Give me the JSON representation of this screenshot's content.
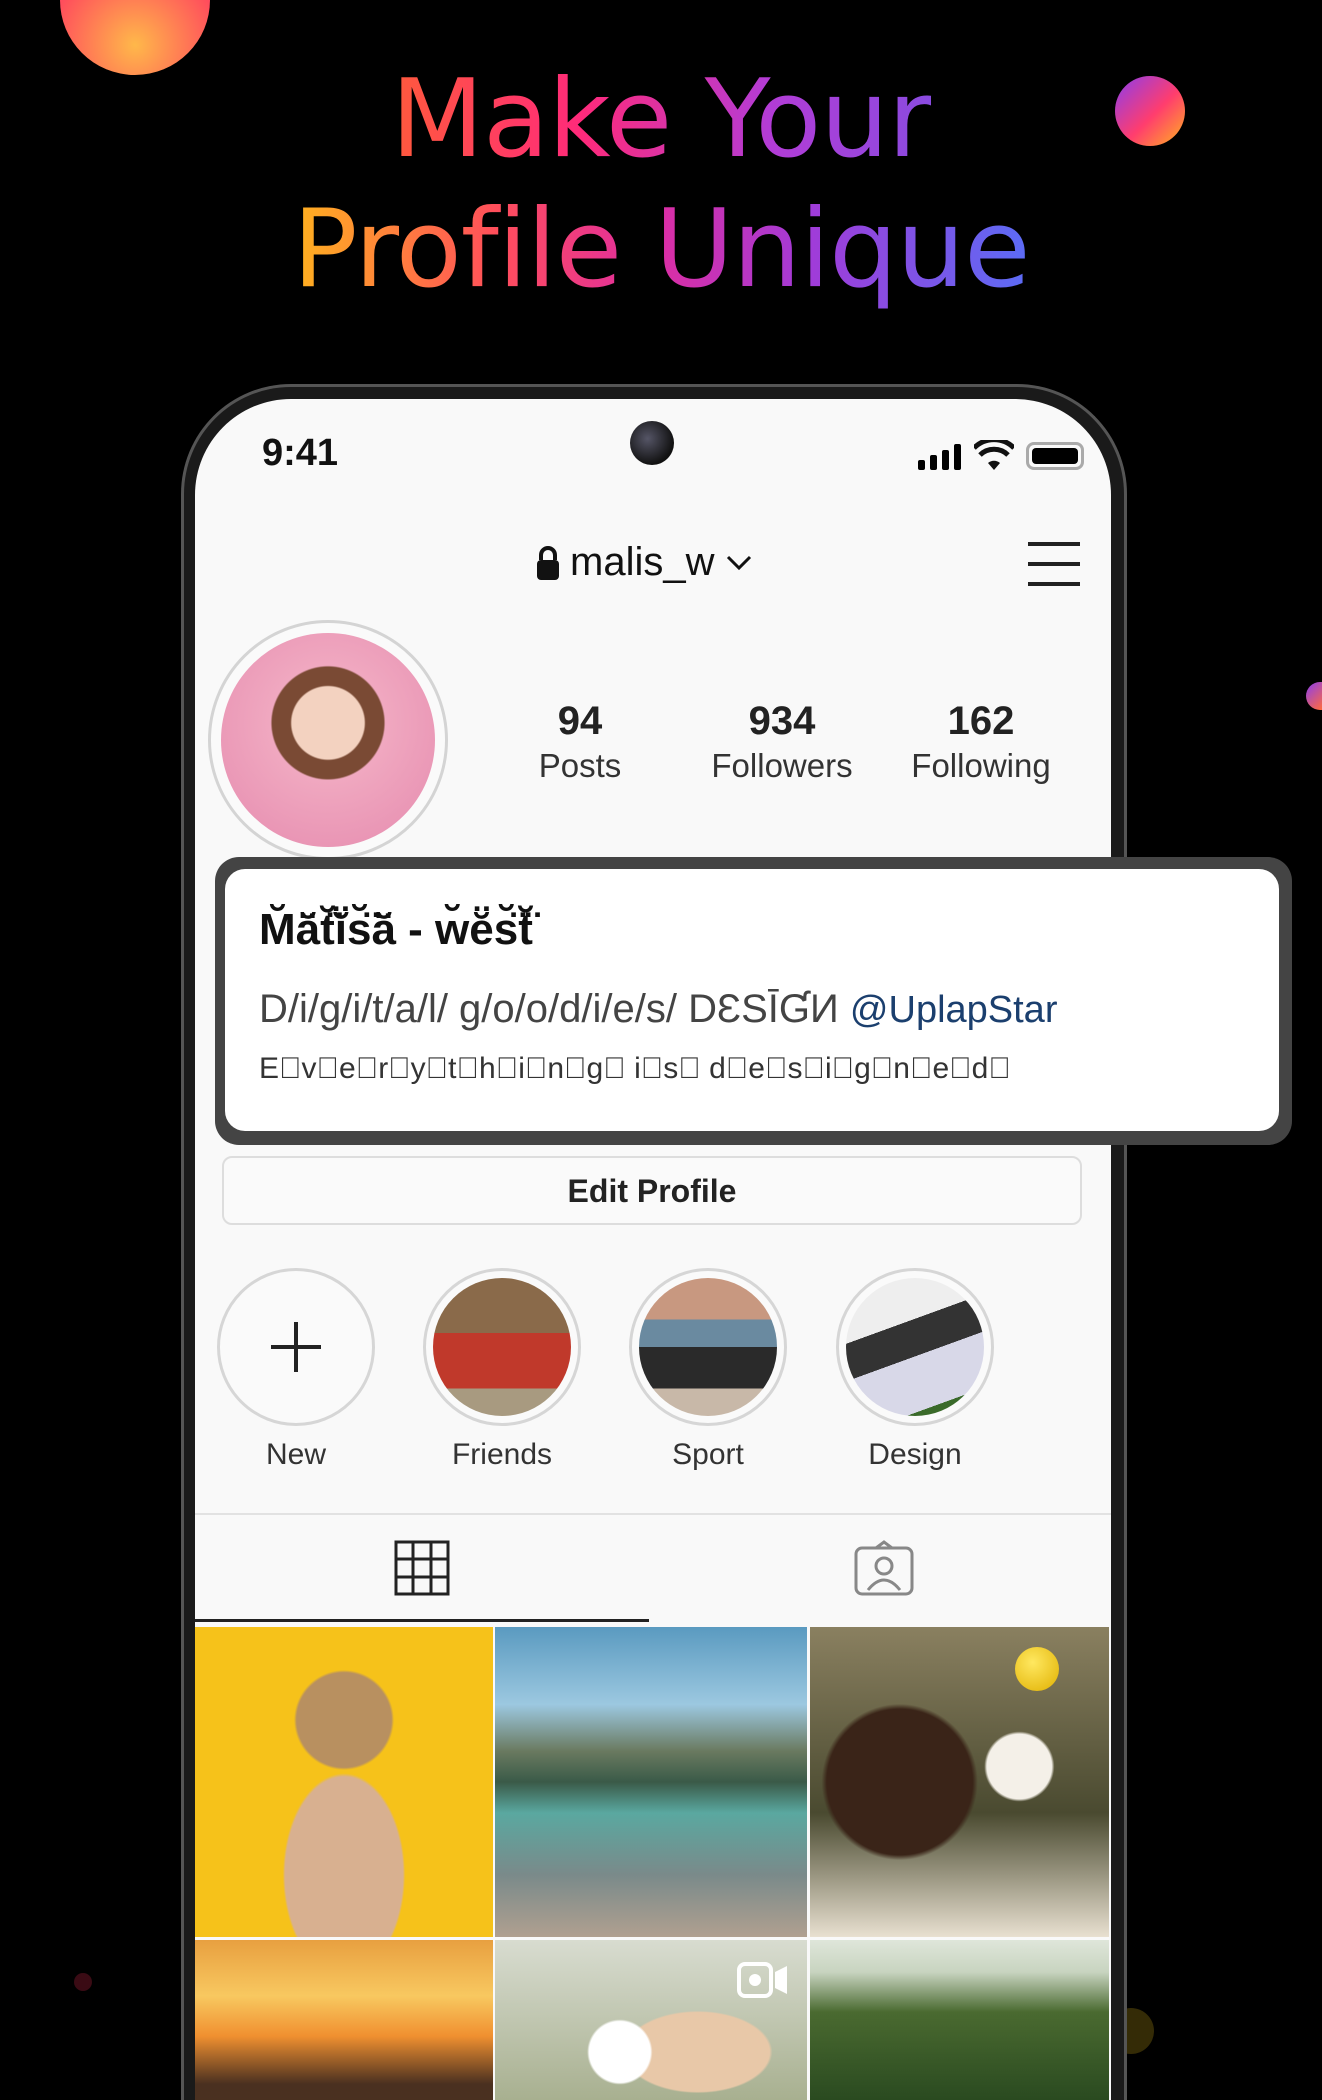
{
  "headline": {
    "line1": "Make Your",
    "line2": "Profile Unique"
  },
  "status_bar": {
    "time": "9:41",
    "icons": [
      "signal-icon",
      "wifi-icon",
      "battery-icon"
    ]
  },
  "header": {
    "username": "malis_w",
    "lock_icon": "lock-icon",
    "dropdown_icon": "chevron-down-icon",
    "menu_icon": "hamburger-icon"
  },
  "stats": [
    {
      "value": "94",
      "label": "Posts"
    },
    {
      "value": "934",
      "label": "Followers"
    },
    {
      "value": "162",
      "label": "Following"
    }
  ],
  "bio": {
    "name": "M̆ă̈t̆̈ĭ̈s̆̈ă̈ - w̆ĕ̈s̆̈t̆̈",
    "line1": "D/i/g/i/t/a/l/ g/o/o/d/i/e/s/ DƐSĪƓИ",
    "mention": "@UplapStar",
    "line2": "E⃠v⃠e⃠r⃠y⃠t⃠h⃠i⃠n⃠g⃠ i⃠s⃠ d⃠e⃠s⃠i⃠g⃠n⃠e⃠d⃠",
    "mention_color": "#1b3f6e"
  },
  "edit_profile": "Edit Profile",
  "highlights": [
    {
      "label": "New",
      "icon": "plus-icon"
    },
    {
      "label": "Friends"
    },
    {
      "label": "Sport"
    },
    {
      "label": "Design"
    }
  ],
  "tabs": [
    {
      "name": "grid",
      "icon": "grid-icon",
      "active": true
    },
    {
      "name": "tagged",
      "icon": "tagged-person-icon",
      "active": false
    }
  ],
  "posts": [
    "yellow-hat-woman",
    "mountain-lake",
    "dandelion-woman",
    "sunset",
    "flower-woman-video",
    "trees"
  ],
  "colors": {
    "accent_start": "#ffb21e",
    "accent_mid": "#e02da0",
    "accent_end": "#5b6cf5"
  }
}
